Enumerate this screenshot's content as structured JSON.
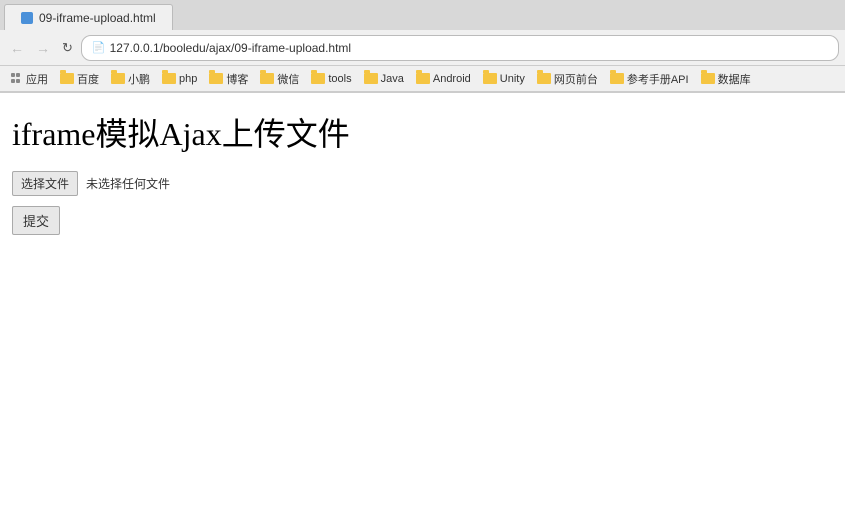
{
  "browser": {
    "tab": {
      "label": "09-iframe-upload.html"
    },
    "nav": {
      "back_label": "←",
      "forward_label": "→",
      "reload_label": "↻",
      "address": "127.0.0.1/booledu/ajax/09-iframe-upload.html"
    },
    "bookmarks": [
      {
        "id": "apps",
        "label": "应用",
        "type": "apps"
      },
      {
        "id": "baidu",
        "label": "百度",
        "type": "folder"
      },
      {
        "id": "xiaoneng",
        "label": "小鹏",
        "type": "folder"
      },
      {
        "id": "php",
        "label": "php",
        "type": "folder"
      },
      {
        "id": "boke",
        "label": "博客",
        "type": "folder"
      },
      {
        "id": "weixin",
        "label": "微信",
        "type": "folder"
      },
      {
        "id": "tools",
        "label": "tools",
        "type": "folder"
      },
      {
        "id": "java",
        "label": "Java",
        "type": "folder"
      },
      {
        "id": "android",
        "label": "Android",
        "type": "folder"
      },
      {
        "id": "unity",
        "label": "Unity",
        "type": "folder"
      },
      {
        "id": "webfront",
        "label": "网页前台",
        "type": "folder"
      },
      {
        "id": "refapi",
        "label": "参考手册API",
        "type": "folder"
      },
      {
        "id": "database",
        "label": "数据库",
        "type": "folder"
      }
    ]
  },
  "page": {
    "title": "iframe模拟Ajax上传文件",
    "file_button_label": "选择文件",
    "file_no_selected_label": "未选择任何文件",
    "submit_label": "提交"
  }
}
